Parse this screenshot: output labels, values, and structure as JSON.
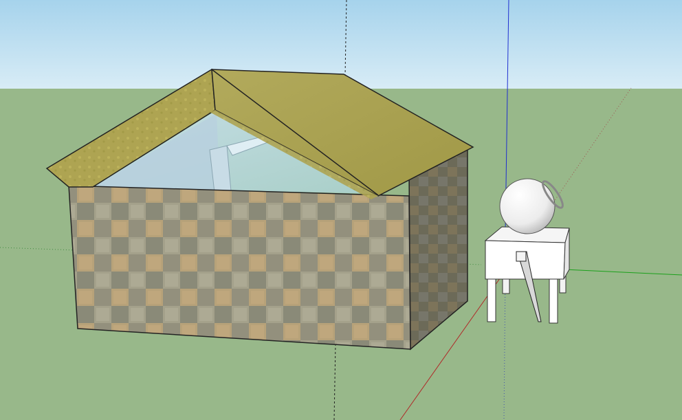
{
  "scene": {
    "sky_color": "#a8d4ec",
    "ground_color": "#98b88a",
    "axis_colors": {
      "red": "#b03030",
      "green": "#20a020",
      "blue": "#2030c8"
    },
    "roof_color": "#a8a050",
    "wall_base_color": "#8c8a70",
    "wall_tile_colors": [
      "#b9a07a",
      "#8c8e7a",
      "#a5a289",
      "#b8a46e",
      "#95927c"
    ],
    "models": [
      "house",
      "sphere-on-table"
    ]
  }
}
